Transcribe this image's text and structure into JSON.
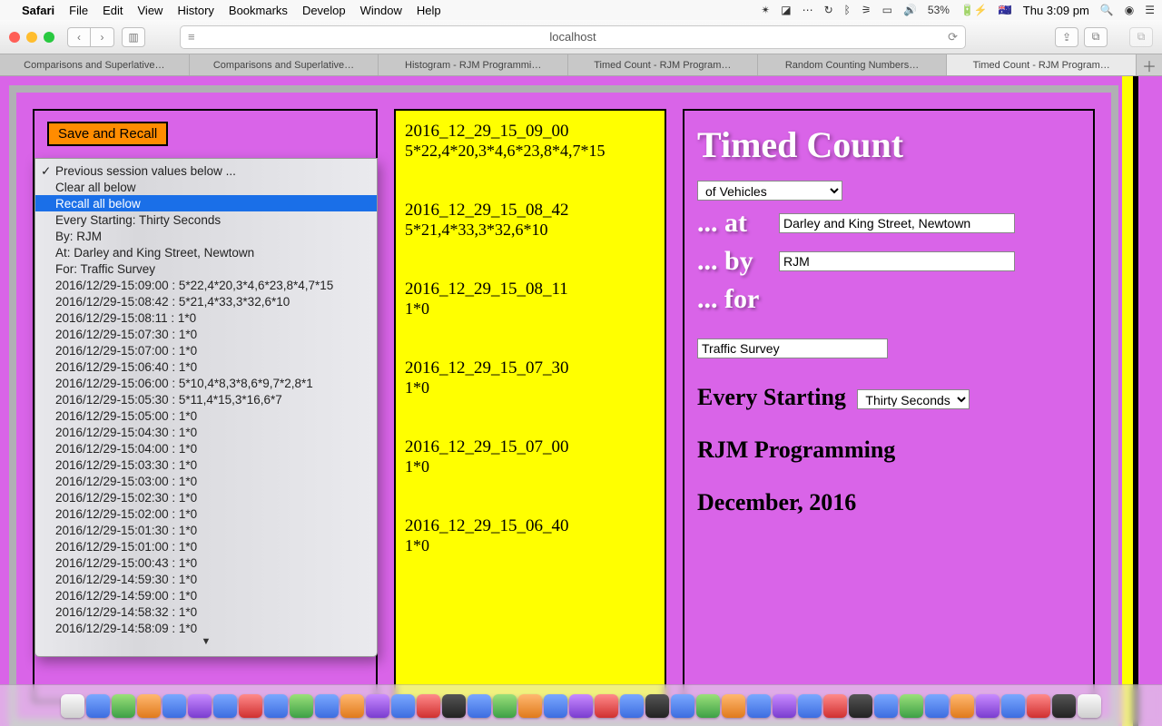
{
  "menubar": {
    "app": "Safari",
    "items": [
      "File",
      "Edit",
      "View",
      "History",
      "Bookmarks",
      "Develop",
      "Window",
      "Help"
    ],
    "battery": "53%",
    "clock": "Thu 3:09 pm"
  },
  "toolbar": {
    "url": "localhost"
  },
  "tabs": [
    {
      "label": "Comparisons and Superlative…"
    },
    {
      "label": "Comparisons and Superlative…"
    },
    {
      "label": "Histogram - RJM Programmi…"
    },
    {
      "label": "Timed Count - RJM Program…"
    },
    {
      "label": "Random Counting Numbers…"
    },
    {
      "label": "Timed Count - RJM Program…",
      "active": true
    }
  ],
  "left_panel": {
    "save_button": "Save and Recall",
    "dropdown": {
      "items": [
        {
          "label": "Previous session values below ...",
          "checked": true
        },
        {
          "label": "Clear all below"
        },
        {
          "label": "Recall all below",
          "selected": true
        },
        {
          "label": "Every Starting: Thirty Seconds"
        },
        {
          "label": "By: RJM"
        },
        {
          "label": "At: Darley and King Street, Newtown"
        },
        {
          "label": "For: Traffic Survey"
        },
        {
          "label": "2016/12/29-15:09:00 : 5*22,4*20,3*4,6*23,8*4,7*15"
        },
        {
          "label": "2016/12/29-15:08:42 : 5*21,4*33,3*32,6*10"
        },
        {
          "label": "2016/12/29-15:08:11 : 1*0"
        },
        {
          "label": "2016/12/29-15:07:30 : 1*0"
        },
        {
          "label": "2016/12/29-15:07:00 : 1*0"
        },
        {
          "label": "2016/12/29-15:06:40 : 1*0"
        },
        {
          "label": "2016/12/29-15:06:00 : 5*10,4*8,3*8,6*9,7*2,8*1"
        },
        {
          "label": "2016/12/29-15:05:30 : 5*11,4*15,3*16,6*7"
        },
        {
          "label": "2016/12/29-15:05:00 : 1*0"
        },
        {
          "label": "2016/12/29-15:04:30 : 1*0"
        },
        {
          "label": "2016/12/29-15:04:00 : 1*0"
        },
        {
          "label": "2016/12/29-15:03:30 : 1*0"
        },
        {
          "label": "2016/12/29-15:03:00 : 1*0"
        },
        {
          "label": "2016/12/29-15:02:30 : 1*0"
        },
        {
          "label": "2016/12/29-15:02:00 : 1*0"
        },
        {
          "label": "2016/12/29-15:01:30 : 1*0"
        },
        {
          "label": "2016/12/29-15:01:00 : 1*0"
        },
        {
          "label": "2016/12/29-15:00:43 : 1*0"
        },
        {
          "label": "2016/12/29-14:59:30 : 1*0"
        },
        {
          "label": "2016/12/29-14:59:00 : 1*0"
        },
        {
          "label": "2016/12/29-14:58:32 : 1*0"
        },
        {
          "label": "2016/12/29-14:58:09 : 1*0"
        }
      ]
    }
  },
  "center_panel": {
    "entries": [
      {
        "ts": "2016_12_29_15_09_00",
        "data": "5*22,4*20,3*4,6*23,8*4,7*15"
      },
      {
        "ts": "2016_12_29_15_08_42",
        "data": "5*21,4*33,3*32,6*10"
      },
      {
        "ts": "2016_12_29_15_08_11",
        "data": "1*0"
      },
      {
        "ts": "2016_12_29_15_07_30",
        "data": "1*0"
      },
      {
        "ts": "2016_12_29_15_07_00",
        "data": "1*0"
      },
      {
        "ts": "2016_12_29_15_06_40",
        "data": "1*0"
      }
    ]
  },
  "right_panel": {
    "title": "Timed Count",
    "of_select": "of Vehicles",
    "at_label": "... at",
    "at_value": "Darley and King Street, Newtown",
    "by_label": "... by",
    "by_value": "RJM",
    "for_label": "... for",
    "for_value": "Traffic Survey",
    "every_label": "Every Starting",
    "every_value": "Thirty Seconds",
    "org": "RJM Programming",
    "date": "December, 2016"
  }
}
